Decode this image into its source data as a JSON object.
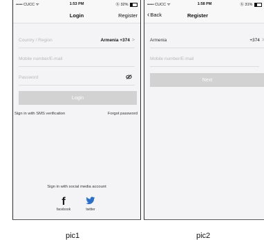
{
  "left_screen": {
    "status": {
      "carrier": "••••• CUCC ᯤ",
      "time": "1:53 PM",
      "battery": "ⓑ 32%"
    },
    "nav": {
      "title": "Login",
      "right": "Register"
    },
    "country_field": {
      "label": "Country / Region",
      "value": "Armenia +374",
      "chevron": ">"
    },
    "mobile_field": {
      "placeholder": "Mobile number/E-mail"
    },
    "password_field": {
      "placeholder": "Password"
    },
    "login_button": "Login",
    "sms_link": "Sign in with SMS verification",
    "forgot_link": "Forgot password",
    "social": {
      "title": "Sign in with social media account",
      "items": [
        {
          "label": "facebook",
          "icon": "facebook-icon",
          "glyph": "f"
        },
        {
          "label": "twitter",
          "icon": "twitter-icon"
        }
      ]
    }
  },
  "right_screen": {
    "status": {
      "carrier": "••••• CUCC ᯤ",
      "time": "1:58 PM",
      "battery": "ⓑ 31%"
    },
    "nav": {
      "back": "Back",
      "title": "Register"
    },
    "country_field": {
      "name": "Armenia",
      "code": "+374",
      "chevron": ">"
    },
    "mobile_field": {
      "placeholder": "Mobile number/E-mail"
    },
    "next_button": "Next"
  },
  "captions": {
    "left": "pic1",
    "right": "pic2"
  },
  "colors": {
    "button_disabled": "#d2d2d2",
    "facebook": "#1a1a1a",
    "twitter": "#2a6fc9",
    "background": "#f4f4f6"
  }
}
